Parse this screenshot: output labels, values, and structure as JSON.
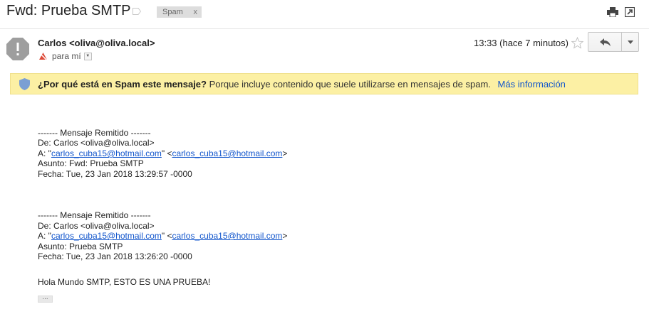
{
  "header": {
    "subject": "Fwd: Prueba SMTP",
    "label_chip": "Spam",
    "label_chip_close": "x"
  },
  "sender": {
    "name_email": "Carlos <oliva@oliva.local>",
    "to": "para mí",
    "time": "13:33 (hace 7 minutos)"
  },
  "warning": {
    "question": "¿Por qué está en Spam este mensaje?",
    "explanation": "Porque incluye contenido que suele utilizarse en mensajes de spam.",
    "link": "Más información"
  },
  "body": {
    "fwd1": {
      "sep": "------- Mensaje Remitido -------",
      "from": "De: Carlos <oliva@oliva.local>",
      "to_prefix": "A: \"",
      "to_link1": "carlos_cuba15@hotmail.com",
      "to_mid": "\" <",
      "to_link2": "carlos_cuba15@hotmail.com",
      "to_suffix": ">",
      "subject": "Asunto: Fwd: Prueba SMTP",
      "date": "Fecha: Tue, 23 Jan 2018 13:29:57 -0000"
    },
    "fwd2": {
      "sep": "------- Mensaje Remitido -------",
      "from": "De: Carlos <oliva@oliva.local>",
      "to_prefix": "A: \"",
      "to_link1": "carlos_cuba15@hotmail.com",
      "to_mid": "\" <",
      "to_link2": "carlos_cuba15@hotmail.com",
      "to_suffix": ">",
      "subject": "Asunto: Prueba SMTP",
      "date": "Fecha: Tue, 23 Jan 2018 13:26:20 -0000"
    },
    "message": "Hola Mundo SMTP, ESTO ES UNA PRUEBA!",
    "ellipsis": "..."
  },
  "colors": {
    "link": "#1155cc",
    "warning_bg": "#fcf0a4",
    "chip_bg": "#dddddd"
  }
}
